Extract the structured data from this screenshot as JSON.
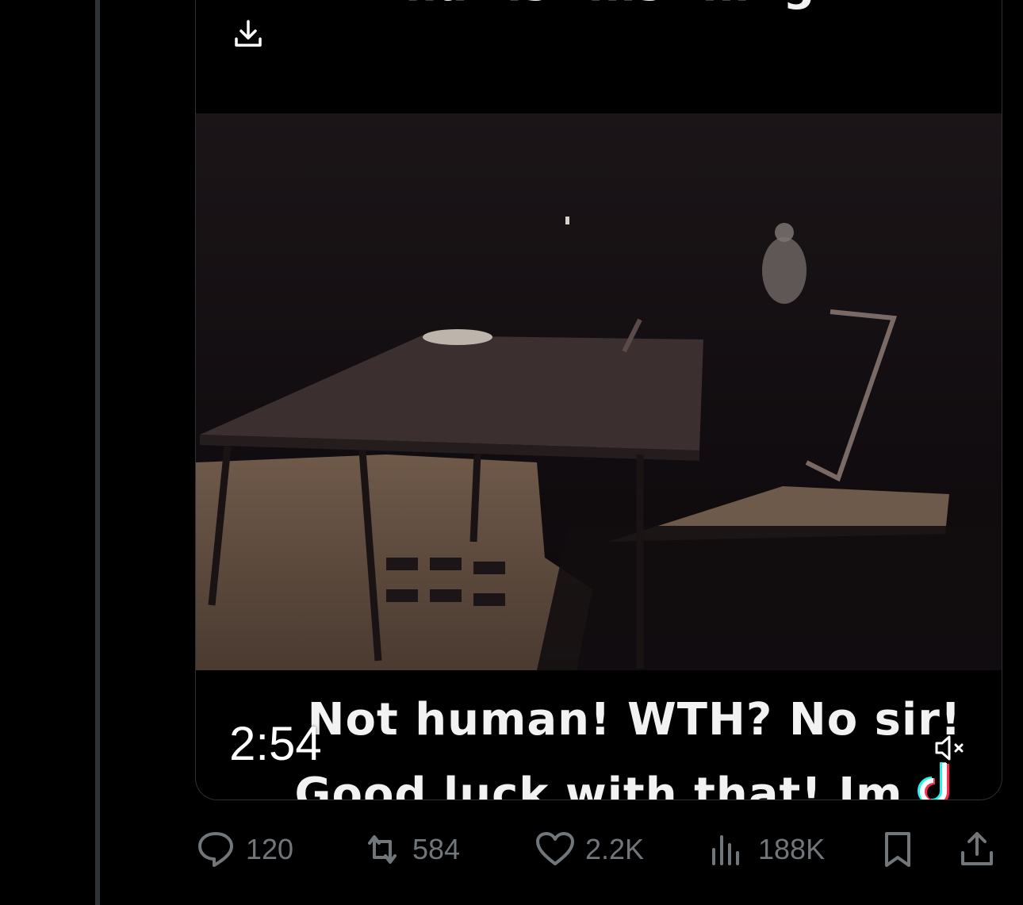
{
  "video": {
    "caption_top": "What is this thing?",
    "caption_line1": "Not human! WTH? No sir!",
    "caption_line2": "Good luck with that! Im",
    "timer": "2:54",
    "icons": [
      "download-icon",
      "mute-icon",
      "tiktok-icon"
    ]
  },
  "actions": {
    "replies": "120",
    "reposts": "584",
    "likes": "2.2K",
    "views": "188K"
  },
  "colors": {
    "background": "#000000",
    "muted_text": "#71767b",
    "border": "#2f3336"
  }
}
